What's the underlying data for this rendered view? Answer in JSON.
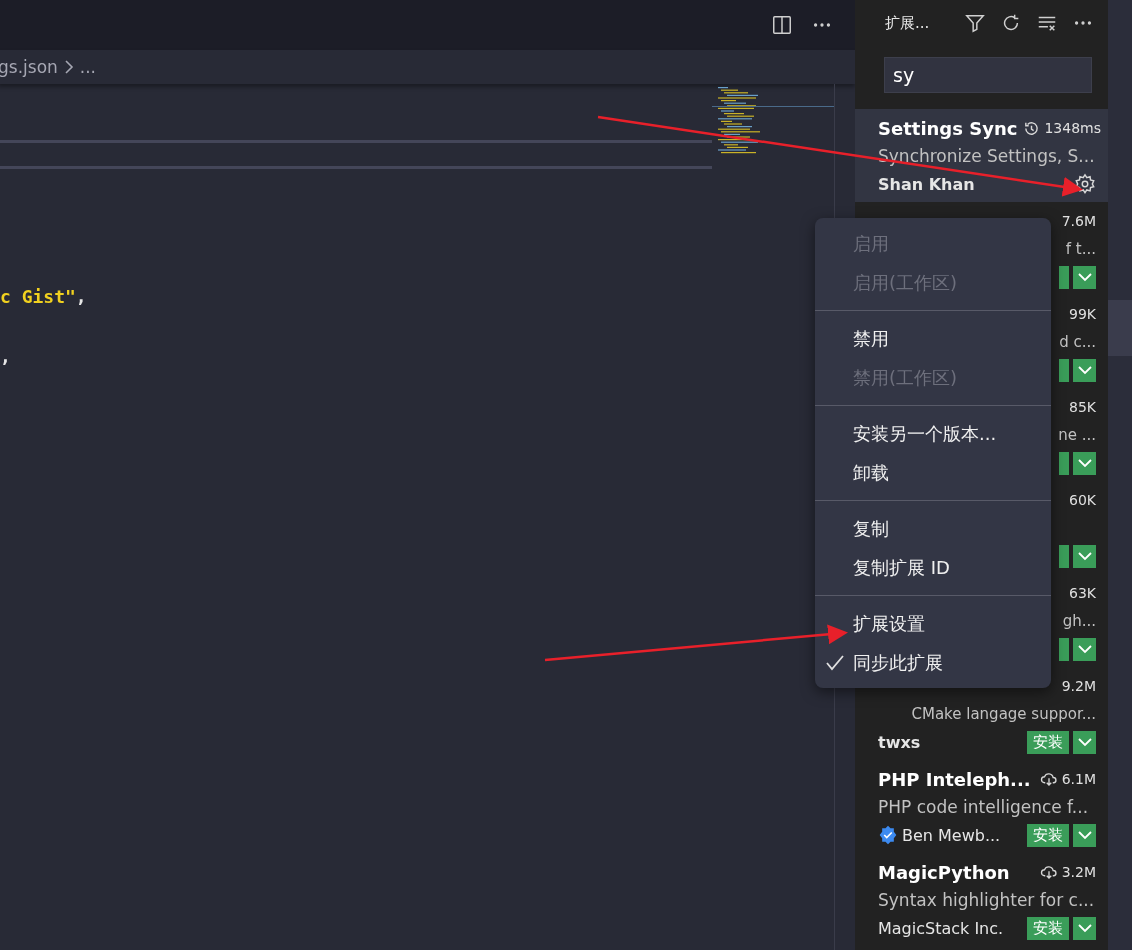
{
  "breadcrumb": {
    "file": "gs.json",
    "more": "..."
  },
  "editor": {
    "lines": [
      {
        "segments": [
          {
            "kind": "string",
            "text": "c Gist\""
          },
          {
            "kind": "punct",
            "text": ","
          }
        ]
      },
      {
        "segments": [
          {
            "kind": "punct",
            "text": ","
          }
        ]
      }
    ]
  },
  "sidebar": {
    "title": "扩展...",
    "search": {
      "value": "sy"
    },
    "extensions": [
      {
        "kind": "full",
        "selected": true,
        "installed": true,
        "name": "Settings Sync",
        "stat": "1348ms",
        "description": "Synchronize Settings, S...",
        "author": "Shan Khan",
        "verified": false
      },
      {
        "kind": "covered",
        "selected": false,
        "stat": "7.6M",
        "description": "f t..."
      },
      {
        "kind": "covered",
        "selected": false,
        "stat": "99K",
        "description": "d c..."
      },
      {
        "kind": "covered",
        "selected": false,
        "stat": "85K",
        "description": "ne ..."
      },
      {
        "kind": "covered",
        "selected": false,
        "stat": "60K"
      },
      {
        "kind": "covered",
        "selected": false,
        "stat": "63K",
        "description": "gh..."
      },
      {
        "kind": "covered",
        "selected": false,
        "stat": "9.2M",
        "description": "CMake langage suppor...",
        "author": "twxs",
        "install_label": "安装"
      },
      {
        "kind": "full",
        "selected": false,
        "installed": false,
        "name": "PHP Inteleph...",
        "stat": "6.1M",
        "description": "PHP code intelligence f...",
        "author": "Ben Mewb...",
        "verified": true,
        "install_label": "安装"
      },
      {
        "kind": "full",
        "selected": false,
        "installed": false,
        "name": "MagicPython",
        "stat": "3.2M",
        "description": "Syntax highlighter for c...",
        "author": "MagicStack Inc.",
        "verified": false,
        "install_label": "安装"
      }
    ]
  },
  "context_menu": {
    "groups": [
      [
        {
          "label": "启用",
          "disabled": true,
          "checked": false
        },
        {
          "label": "启用(工作区)",
          "disabled": true,
          "checked": false
        }
      ],
      [
        {
          "label": "禁用",
          "disabled": false,
          "checked": false
        },
        {
          "label": "禁用(工作区)",
          "disabled": true,
          "checked": false
        }
      ],
      [
        {
          "label": "安装另一个版本...",
          "disabled": false,
          "checked": false
        },
        {
          "label": "卸载",
          "disabled": false,
          "checked": false
        }
      ],
      [
        {
          "label": "复制",
          "disabled": false,
          "checked": false
        },
        {
          "label": "复制扩展 ID",
          "disabled": false,
          "checked": false
        }
      ],
      [
        {
          "label": "扩展设置",
          "disabled": false,
          "checked": false
        },
        {
          "label": "同步此扩展",
          "disabled": false,
          "checked": true
        }
      ]
    ]
  }
}
